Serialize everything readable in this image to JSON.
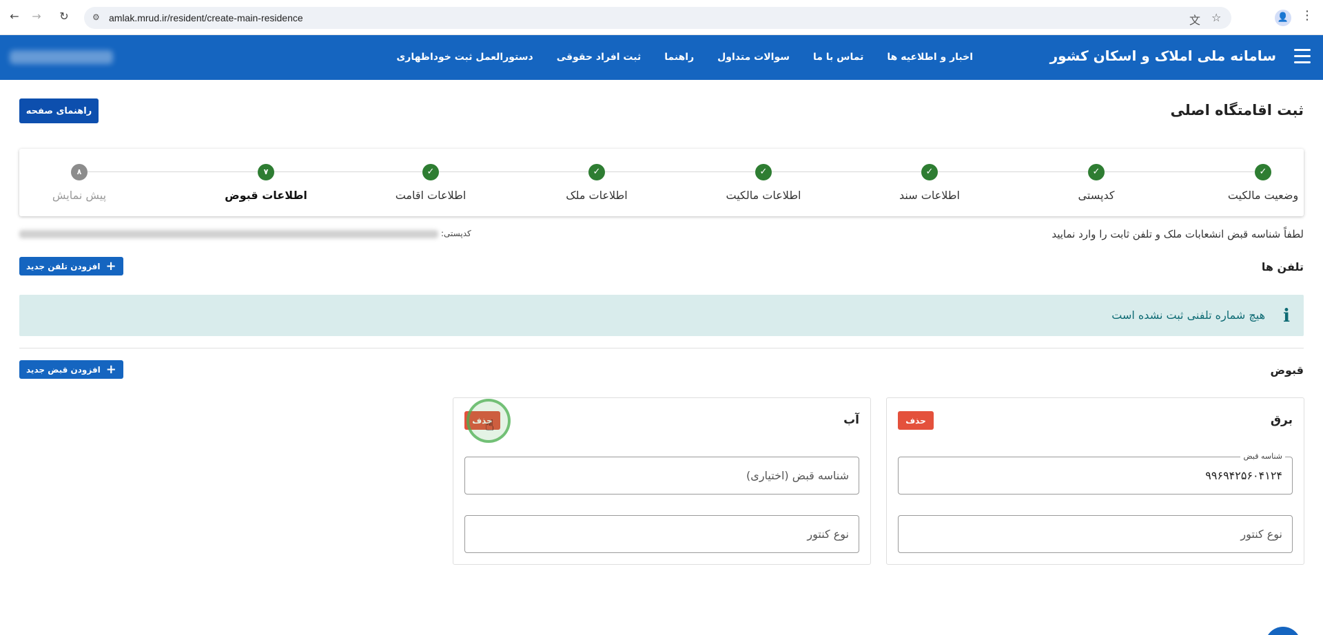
{
  "browser": {
    "url": "amlak.mrud.ir/resident/create-main-residence",
    "back_icon": "←",
    "forward_icon": "→",
    "reload_icon": "↻",
    "site_info_icon": "⚙",
    "translate_icon": "文",
    "bookmark_icon": "☆",
    "profile_icon": "👤",
    "menu_icon": "⋮"
  },
  "header": {
    "brand": "سامانه ملی املاک و اسکان کشور",
    "menu": [
      "اخبار و اطلاعیه ها",
      "تماس با ما",
      "سوالات متداول",
      "راهنما",
      "ثبت افراد حقوقی",
      "دستورالعمل ثبت خوداظهاری"
    ]
  },
  "page": {
    "title": "ثبت اقامتگاه اصلی",
    "guide_button": "راهنمای صفحه"
  },
  "stepper": {
    "steps": [
      {
        "label": "وضعیت مالکیت",
        "status": "done",
        "icon": "✓"
      },
      {
        "label": "کدپستی",
        "status": "done",
        "icon": "✓"
      },
      {
        "label": "اطلاعات سند",
        "status": "done",
        "icon": "✓"
      },
      {
        "label": "اطلاعات مالکیت",
        "status": "done",
        "icon": "✓"
      },
      {
        "label": "اطلاعات ملک",
        "status": "done",
        "icon": "✓"
      },
      {
        "label": "اطلاعات اقامت",
        "status": "done",
        "icon": "✓"
      },
      {
        "label": "اطلاعات قبوض",
        "status": "current",
        "icon": "۷"
      },
      {
        "label": "پیش نمایش",
        "status": "pending",
        "icon": "۸"
      }
    ]
  },
  "instruction": "لطفاً شناسه قبض انشعابات ملک و تلفن ثابت را وارد نمایید",
  "postal_label": "کدپستی:",
  "phones": {
    "title": "تلفن ها",
    "add_button": "افزودن تلفن جدید",
    "empty_icon": "i",
    "empty_message": "هیچ شماره تلفنی ثبت نشده است"
  },
  "bills": {
    "title": "قبوض",
    "add_button": "افزودن قبض جدید",
    "plus_icon": "+",
    "delete_label": "حذف",
    "electricity": {
      "title": "برق",
      "bill_id_label": "شناسه قبض",
      "bill_id_value": "۹۹۶۹۴۲۵۶۰۴۱۲۴",
      "meter_placeholder": "نوع کنتور"
    },
    "water": {
      "title": "آب",
      "bill_id_placeholder": "شناسه قبض (اختیاری)",
      "meter_placeholder": "نوع کنتور"
    }
  },
  "cursor_icon": "☝"
}
